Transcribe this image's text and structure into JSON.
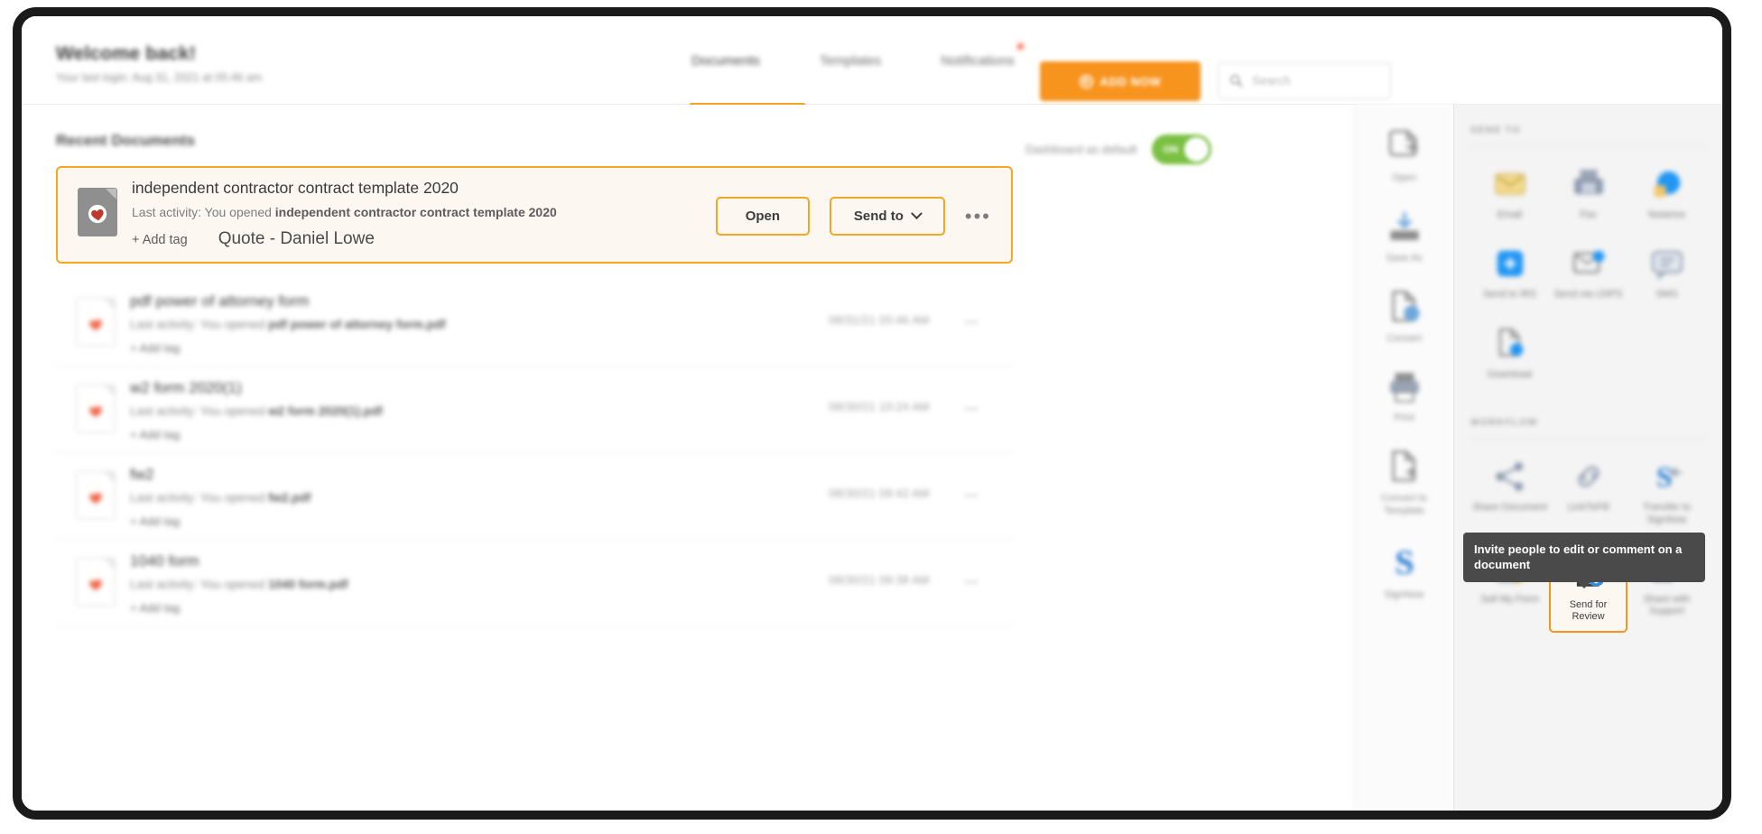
{
  "header": {
    "welcome_title": "Welcome back!",
    "welcome_sub": "Your last login: Aug 31, 2021 at 05:46 am",
    "nav": [
      {
        "label": "Documents",
        "active": true
      },
      {
        "label": "Templates",
        "active": false
      },
      {
        "label": "Notifications",
        "active": false,
        "badge": true
      }
    ],
    "add_now_label": "ADD NOW",
    "add_now_icon": "plus-circle-icon",
    "search_placeholder": "Search",
    "search_icon": "search-icon"
  },
  "main": {
    "section_title": "Recent Documents",
    "dashboard_default_label": "Dashboard as default",
    "toggle_state": "ON",
    "toggle_color": "#7bc043",
    "accent_color": "#f7941e"
  },
  "highlighted_document": {
    "name": "independent contractor contract template 2020",
    "activity_prefix": "Last activity: You opened ",
    "activity_file": "independent contractor contract template 2020",
    "add_tag_label": "+ Add tag",
    "tag": "Quote - Daniel Lowe",
    "open_label": "Open",
    "send_to_label": "Send to",
    "more_label": "•••"
  },
  "documents": [
    {
      "name": "pdf power of attorney form",
      "activity_prefix": "Last activity: You opened ",
      "activity_file": "pdf power of attorney form.pdf",
      "add_tag_label": "+ Add tag",
      "date": "08/31/21 05:46 AM",
      "more_label": "—"
    },
    {
      "name": "w2 form 2020(1)",
      "activity_prefix": "Last activity: You opened ",
      "activity_file": "w2 form 2020(1).pdf",
      "add_tag_label": "+ Add tag",
      "date": "08/30/21 10:24 AM",
      "more_label": "—"
    },
    {
      "name": "fw2",
      "activity_prefix": "Last activity: You opened ",
      "activity_file": "fw2.pdf",
      "add_tag_label": "+ Add tag",
      "date": "08/30/21 09:42 AM",
      "more_label": "—"
    },
    {
      "name": "1040 form",
      "activity_prefix": "Last activity: You opened ",
      "activity_file": "1040 form.pdf",
      "add_tag_label": "+ Add tag",
      "date": "08/30/21 09:38 AM",
      "more_label": "—"
    }
  ],
  "tool_rail": [
    {
      "label": "Open",
      "icon": "document-open-icon"
    },
    {
      "label": "Save As",
      "icon": "save-as-icon"
    },
    {
      "label": "Convert",
      "icon": "convert-icon"
    },
    {
      "label": "Print",
      "icon": "printer-icon"
    },
    {
      "label": "Convert to\nTemplate",
      "icon": "convert-to-template-icon"
    },
    {
      "label": "SignNow",
      "icon": "signnow-logo-icon"
    }
  ],
  "right_panel": {
    "send_to": {
      "title": "SEND TO",
      "tiles": [
        {
          "label": "Email",
          "icon": "email-icon"
        },
        {
          "label": "Fax",
          "icon": "fax-icon"
        },
        {
          "label": "Notarize",
          "icon": "notarize-icon"
        },
        {
          "label": "Send to IRS",
          "icon": "send-to-irs-icon"
        },
        {
          "label": "Send via USPS",
          "icon": "send-via-usps-icon"
        },
        {
          "label": "SMS",
          "icon": "sms-icon"
        },
        {
          "label": "Download",
          "icon": "download-icon"
        }
      ]
    },
    "workflow": {
      "title": "WORKFLOW",
      "tiles": [
        {
          "label": "Share Document",
          "icon": "share-document-icon",
          "selected": false
        },
        {
          "label": "LinkToFill",
          "icon": "linktofill-icon",
          "selected": false
        },
        {
          "label": "Transfer to SignNow",
          "icon": "transfer-to-signnow-icon",
          "selected": false
        },
        {
          "label": "Sell My Form",
          "icon": "sell-my-form-icon",
          "selected": false
        },
        {
          "label": "Send for Review",
          "icon": "send-for-review-icon",
          "selected": true
        },
        {
          "label": "Share with Support",
          "icon": "share-with-support-icon",
          "selected": false
        }
      ]
    },
    "tooltip": "Invite people to edit or comment on a document"
  }
}
